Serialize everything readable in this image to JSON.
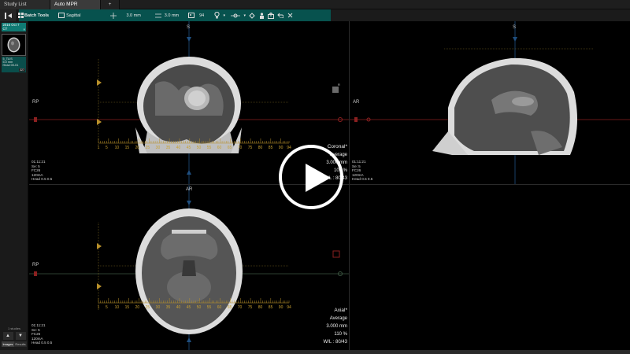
{
  "tabs": [
    {
      "label": "Study List"
    },
    {
      "label": "Auto MPR"
    },
    {
      "label": "+"
    }
  ],
  "toolbar": {
    "batch_tools_label": "Batch Tools",
    "plane_label": "Sagittal",
    "thickness_1": "3.0 mm",
    "thickness_2": "3.0 mm",
    "count": "94"
  },
  "left_panel": {
    "study_date": "2016 Oct 7",
    "study_modality": "CT",
    "study_close": "×",
    "series_line1": "5_TLIS",
    "series_line2": "5.0 mm",
    "series_line3": "Head 00-01",
    "series_count": "327",
    "status": "1 studies",
    "up_arrow": "▲",
    "down_arrow": "▼",
    "tab_images": "Images",
    "tab_results": "Results"
  },
  "viewports": {
    "coronal": {
      "top_label": "S",
      "left_label": "RP",
      "info": [
        "01:11:21",
        "Se: 5",
        "FC26",
        "120mA",
        "Head 0.5 0.5"
      ],
      "plane": "Coronal*",
      "mode": "Average",
      "thickness": "3.000 mm",
      "zoom": "109 %",
      "wl": "W/L : 80/43",
      "ruler_labels": [
        "1",
        "5",
        "10",
        "15",
        "20",
        "25",
        "30",
        "35",
        "40",
        "45",
        "50",
        "55",
        "60",
        "65",
        "70",
        "75",
        "80",
        "85",
        "90",
        "94"
      ]
    },
    "sagittal": {
      "top_label": "S",
      "left_label": "AR",
      "info": [
        "01:11:21",
        "Se: 5",
        "FC26",
        "120mA",
        "Head 0.5 0.5"
      ]
    },
    "axial": {
      "top_label": "AR",
      "left_label": "RP",
      "info": [
        "01:11:21",
        "Se: 5",
        "FC26",
        "120mA",
        "Head 0.5 0.5"
      ],
      "plane": "Axial*",
      "mode": "Average",
      "thickness": "3.000 mm",
      "zoom": "110 %",
      "wl": "W/L : 80/43",
      "ruler_labels": [
        "1",
        "5",
        "10",
        "15",
        "20",
        "25",
        "30",
        "35",
        "40",
        "45",
        "50",
        "55",
        "60",
        "65",
        "70",
        "75",
        "80",
        "85",
        "90",
        "94"
      ]
    }
  },
  "colors": {
    "accent_teal": "#07524e",
    "crosshair_red": "#c0392b",
    "crosshair_blue": "#2b6cb0",
    "ruler_yellow": "#c8a030"
  }
}
